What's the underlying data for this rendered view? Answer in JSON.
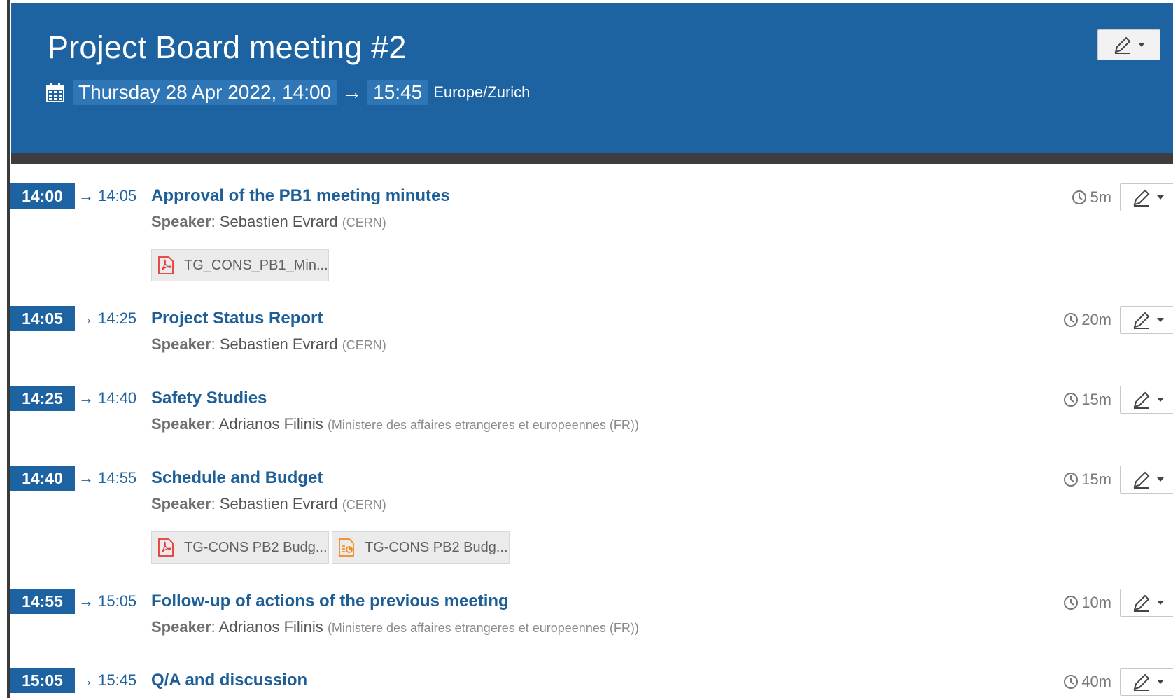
{
  "event": {
    "title": "Project Board meeting #2",
    "start": "Thursday 28 Apr 2022, 14:00",
    "arrow": "→",
    "end": "15:45",
    "timezone": "Europe/Zurich"
  },
  "colors": {
    "header": "#1e63a1",
    "accent": "#1f5f98",
    "pdf": "#e53935",
    "ppt": "#ef8a1e"
  },
  "entries": [
    {
      "start": "14:00",
      "end": "→ 14:05",
      "title": "Approval of the PB1 meeting minutes",
      "speaker_label": "Speaker",
      "speaker": "Sebastien Evrard",
      "affiliation": "(CERN)",
      "duration": "5m",
      "attachments": [
        {
          "name": "TG_CONS_PB1_Min...",
          "icon": "pdf-icon"
        }
      ]
    },
    {
      "start": "14:05",
      "end": "→ 14:25",
      "title": "Project Status Report",
      "speaker_label": "Speaker",
      "speaker": "Sebastien Evrard",
      "affiliation": "(CERN)",
      "duration": "20m",
      "attachments": []
    },
    {
      "start": "14:25",
      "end": "→ 14:40",
      "title": "Safety Studies",
      "speaker_label": "Speaker",
      "speaker": "Adrianos Filinis",
      "affiliation": "(Ministere des affaires etrangeres et europeennes (FR))",
      "duration": "15m",
      "attachments": []
    },
    {
      "start": "14:40",
      "end": "→ 14:55",
      "title": "Schedule and Budget",
      "speaker_label": "Speaker",
      "speaker": "Sebastien Evrard",
      "affiliation": "(CERN)",
      "duration": "15m",
      "attachments": [
        {
          "name": "TG-CONS PB2 Budg...",
          "icon": "pdf-icon"
        },
        {
          "name": "TG-CONS PB2 Budg...",
          "icon": "presentation-icon"
        }
      ]
    },
    {
      "start": "14:55",
      "end": "→ 15:05",
      "title": "Follow-up of actions of the previous meeting",
      "speaker_label": "Speaker",
      "speaker": "Adrianos Filinis",
      "affiliation": "(Ministere des affaires etrangeres et europeennes (FR))",
      "duration": "10m",
      "attachments": []
    },
    {
      "start": "15:05",
      "end": "→ 15:45",
      "title": "Q/A and discussion",
      "duration": "40m",
      "attachments": []
    }
  ]
}
